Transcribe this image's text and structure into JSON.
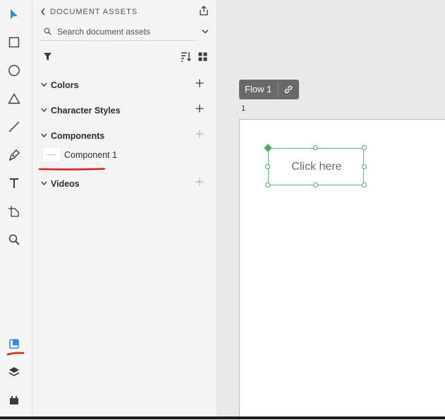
{
  "assets_panel": {
    "title": "DOCUMENT ASSETS",
    "search": {
      "placeholder": "Search document assets"
    },
    "sections": [
      {
        "label": "Colors"
      },
      {
        "label": "Character Styles"
      },
      {
        "label": "Components",
        "items": [
          {
            "label": "Component 1"
          }
        ]
      },
      {
        "label": "Videos"
      }
    ]
  },
  "canvas": {
    "flow": {
      "label": "Flow 1"
    },
    "artboard": {
      "number": "1"
    },
    "component_instance": {
      "text": "Click here"
    }
  },
  "colors": {
    "accent": "#2d8ceb",
    "selection": "#43b05b",
    "annotation": "#e02020"
  },
  "icons": [
    "select-icon",
    "rectangle-icon",
    "ellipse-icon",
    "polygon-icon",
    "line-icon",
    "pen-icon",
    "text-icon",
    "artboard-icon",
    "zoom-icon",
    "assets-icon",
    "layers-icon",
    "plugins-icon",
    "share-icon",
    "filter-icon",
    "sort-icon",
    "grid-view-icon",
    "link-icon"
  ]
}
